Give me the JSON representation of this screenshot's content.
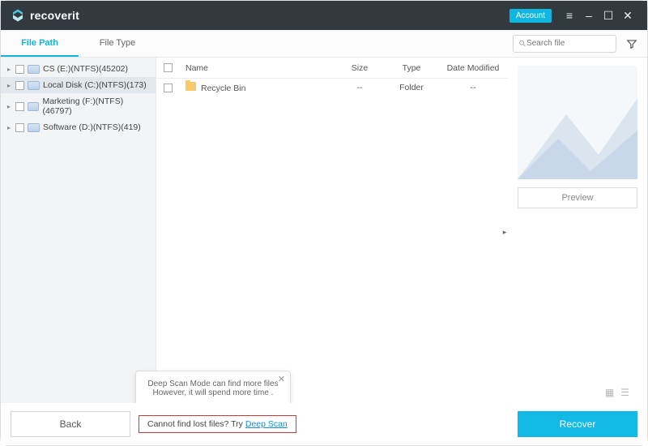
{
  "titlebar": {
    "brand": "recoverit",
    "account_label": "Account"
  },
  "tabs": {
    "file_path": "File Path",
    "file_type": "File Type"
  },
  "search": {
    "placeholder": "Search file"
  },
  "sidebar": {
    "items": [
      {
        "label": "CS (E:)(NTFS)(45202)"
      },
      {
        "label": "Local Disk (C:)(NTFS)(173)"
      },
      {
        "label": "Marketing (F:)(NTFS)(46797)"
      },
      {
        "label": "Software (D:)(NTFS)(419)"
      }
    ]
  },
  "table": {
    "headers": {
      "name": "Name",
      "size": "Size",
      "type": "Type",
      "date": "Date Modified"
    },
    "rows": [
      {
        "name": "Recycle Bin",
        "size": "--",
        "type": "Folder",
        "date": "--"
      }
    ]
  },
  "preview": {
    "button": "Preview"
  },
  "tooltip": {
    "line1": "Deep Scan Mode can find more files",
    "line2": "However, it will spend more time ."
  },
  "deepscan": {
    "prefix": "Cannot find lost files? Try ",
    "link": "Deep Scan"
  },
  "footer": {
    "back": "Back",
    "recover": "Recover"
  }
}
